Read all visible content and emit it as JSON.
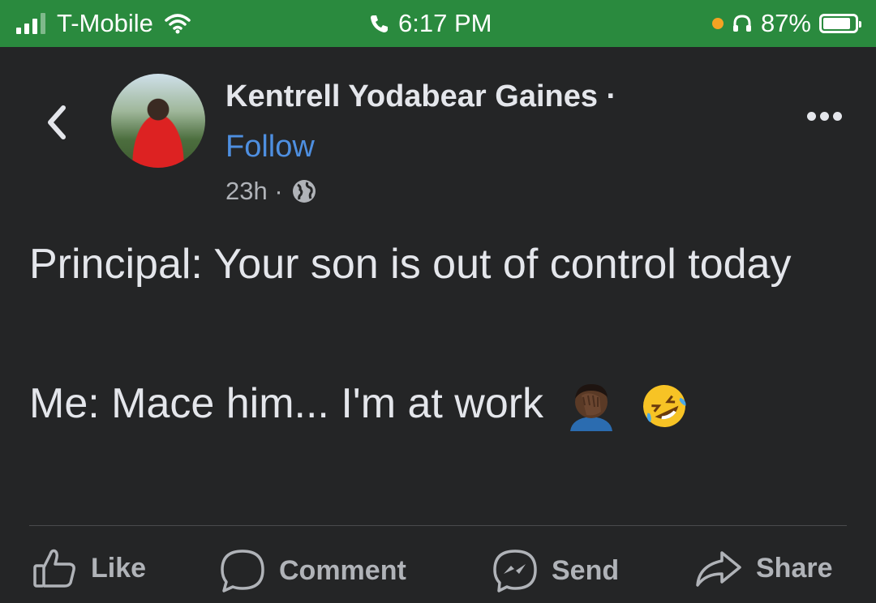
{
  "status_bar": {
    "carrier": "T-Mobile",
    "time": "6:17 PM",
    "battery": "87%",
    "battery_fraction": 0.87,
    "signal_bars": 3
  },
  "post": {
    "author": "Kentrell Yodabear Gaines ·",
    "follow_label": "Follow",
    "timestamp": "23h ·",
    "privacy_icon": "globe-icon",
    "line1": "Principal: Your son is out of control today",
    "line2": "Me: Mace him... I'm at work",
    "emojis": [
      "facepalm-emoji",
      "rofl-emoji"
    ]
  },
  "actions": {
    "like": "Like",
    "comment": "Comment",
    "send": "Send",
    "share": "Share"
  },
  "colors": {
    "status_bar": "#2a8a3e",
    "background": "#242526",
    "link": "#4e8fe0",
    "text": "#e4e6eb",
    "muted": "#b0b3b8"
  }
}
